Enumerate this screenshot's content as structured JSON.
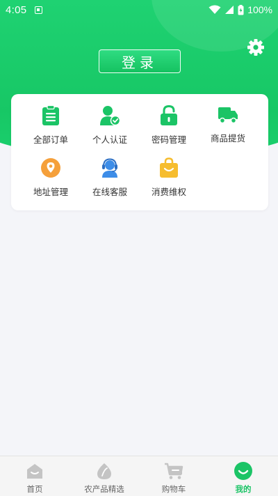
{
  "status_bar": {
    "time": "4:05",
    "battery": "100%"
  },
  "header": {
    "login_label": "登录",
    "settings_icon": "gear-icon"
  },
  "menu": [
    {
      "label": "全部订单",
      "icon": "order-list-icon",
      "color": "#1bc466"
    },
    {
      "label": "个人认证",
      "icon": "user-verified-icon",
      "color": "#1bc466"
    },
    {
      "label": "密码管理",
      "icon": "lock-icon",
      "color": "#1bc466"
    },
    {
      "label": "商品提货",
      "icon": "truck-icon",
      "color": "#1bc466"
    },
    {
      "label": "地址管理",
      "icon": "location-pin-icon",
      "color": "#f5a03b"
    },
    {
      "label": "在线客服",
      "icon": "headset-icon",
      "color": "#3d8de8"
    },
    {
      "label": "消费维权",
      "icon": "shopping-bag-icon",
      "color": "#f6bd2f"
    }
  ],
  "tab_bar": [
    {
      "label": "首页",
      "icon": "home-icon",
      "active": false
    },
    {
      "label": "农产品精选",
      "icon": "produce-icon",
      "active": false
    },
    {
      "label": "购物车",
      "icon": "cart-icon",
      "active": false
    },
    {
      "label": "我的",
      "icon": "profile-smile-icon",
      "active": true
    }
  ],
  "colors": {
    "brand_green": "#1bc466",
    "background": "#f4f5f9",
    "inactive_icon": "#c4c4c4"
  }
}
